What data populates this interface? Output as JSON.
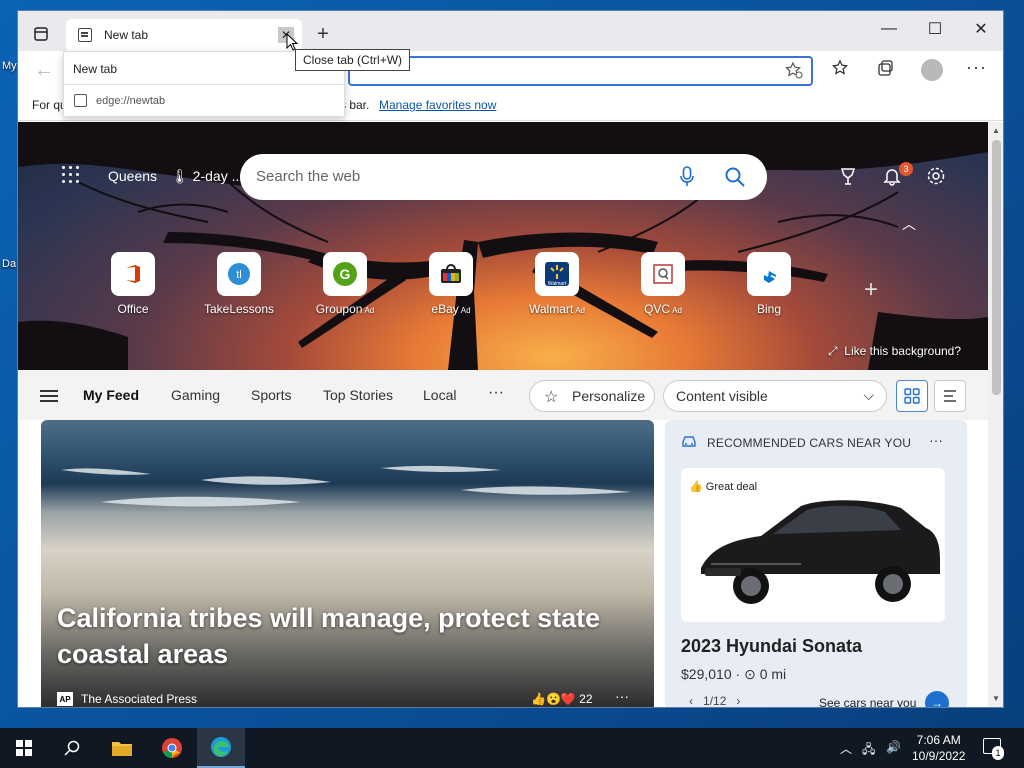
{
  "desktop": {
    "icon_labels": [
      "My",
      "Da"
    ]
  },
  "browser": {
    "tab": {
      "title": "New tab",
      "close_glyph": "✕"
    },
    "new_tab_glyph": "+",
    "window_controls": {
      "minimize": "—",
      "maximize": "☐",
      "close": "✕"
    },
    "hovercard": {
      "title": "New tab",
      "url": "edge://newtab"
    },
    "tooltip": "Close tab (Ctrl+W)",
    "favbar": {
      "prefix": "For qu",
      "suffix": "s bar.",
      "link": "Manage favorites now"
    }
  },
  "newtab": {
    "location": "Queens",
    "weather": "2-day ...",
    "search_placeholder": "Search the web",
    "notification_count": "3",
    "tiles": [
      {
        "label": "Office",
        "ad": "",
        "icon": "office-icon",
        "color": "#d83b01"
      },
      {
        "label": "TakeLessons",
        "ad": "",
        "icon": "takelessons-icon",
        "color": "#2e8fd6"
      },
      {
        "label": "Groupon",
        "ad": "Ad",
        "icon": "groupon-icon",
        "color": "#53a318"
      },
      {
        "label": "eBay",
        "ad": "Ad",
        "icon": "ebay-icon",
        "color": "#e53238"
      },
      {
        "label": "Walmart",
        "ad": "Ad",
        "icon": "walmart-icon",
        "color": "#0071ce"
      },
      {
        "label": "QVC",
        "ad": "Ad",
        "icon": "qvc-icon",
        "color": "#b83a3a"
      },
      {
        "label": "Bing",
        "ad": "",
        "icon": "bing-icon",
        "color": "#0078d4"
      }
    ],
    "like_background": "Like this background?"
  },
  "feed": {
    "tabs": [
      "My Feed",
      "Gaming",
      "Sports",
      "Top Stories",
      "Local"
    ],
    "more": "···",
    "personalize": "Personalize",
    "content_visibility": "Content visible",
    "main_story": {
      "headline": "California tribes will manage, protect state coastal areas",
      "source_logo": "AP",
      "source": "The Associated Press",
      "reactions": "22",
      "more": "···"
    },
    "cars": {
      "heading": "RECOMMENDED CARS NEAR YOU",
      "more": "···",
      "deal": "Great deal",
      "name": "2023 Hyundai Sonata",
      "price": "$29,010 · ",
      "mileage": "0 mi",
      "pager": "1/12",
      "see_cars": "See cars near you"
    }
  },
  "taskbar": {
    "time": "7:06 AM",
    "date": "10/9/2022",
    "notification_count": "1"
  }
}
